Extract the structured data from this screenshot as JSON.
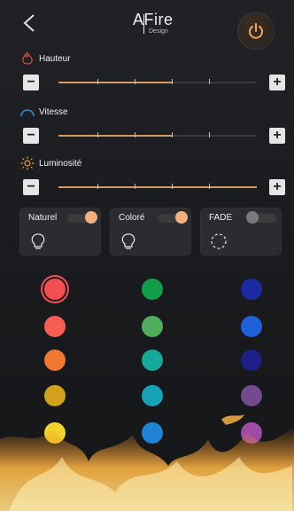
{
  "header": {
    "logo_big": "AFire",
    "logo_small": "Design"
  },
  "sliders": [
    {
      "label": "Hauteur",
      "icon": "flame-icon",
      "value": 0.57
    },
    {
      "label": "Vitesse",
      "icon": "speed-gauge-icon",
      "value": 0.57
    },
    {
      "label": "Luminosité",
      "icon": "sun-icon",
      "value": 1.0
    }
  ],
  "buttons": {
    "minus": "−",
    "plus": "+"
  },
  "modes": [
    {
      "label": "Naturel",
      "state": "on",
      "icon": "bulb-icon"
    },
    {
      "label": "Coloré",
      "state": "on",
      "icon": "bulb-icon"
    },
    {
      "label": "FADE",
      "state": "off",
      "icon": "dashed-circle-icon"
    }
  ],
  "colors": {
    "accent": "#d49a61",
    "selected_ring": "#f44d52",
    "palette": [
      [
        "#f44d52",
        "#129e46",
        "#1b2aa2"
      ],
      [
        "#f65f54",
        "#4fae5b",
        "#1f61d8"
      ],
      [
        "#f17832",
        "#17a89c",
        "#1e1f86"
      ],
      [
        "#d1a21a",
        "#16a2b6",
        "#73498f"
      ],
      [
        "#f1d12b",
        "#1f84d3",
        "#a04aa7"
      ]
    ],
    "selected_index": [
      0,
      0
    ]
  }
}
